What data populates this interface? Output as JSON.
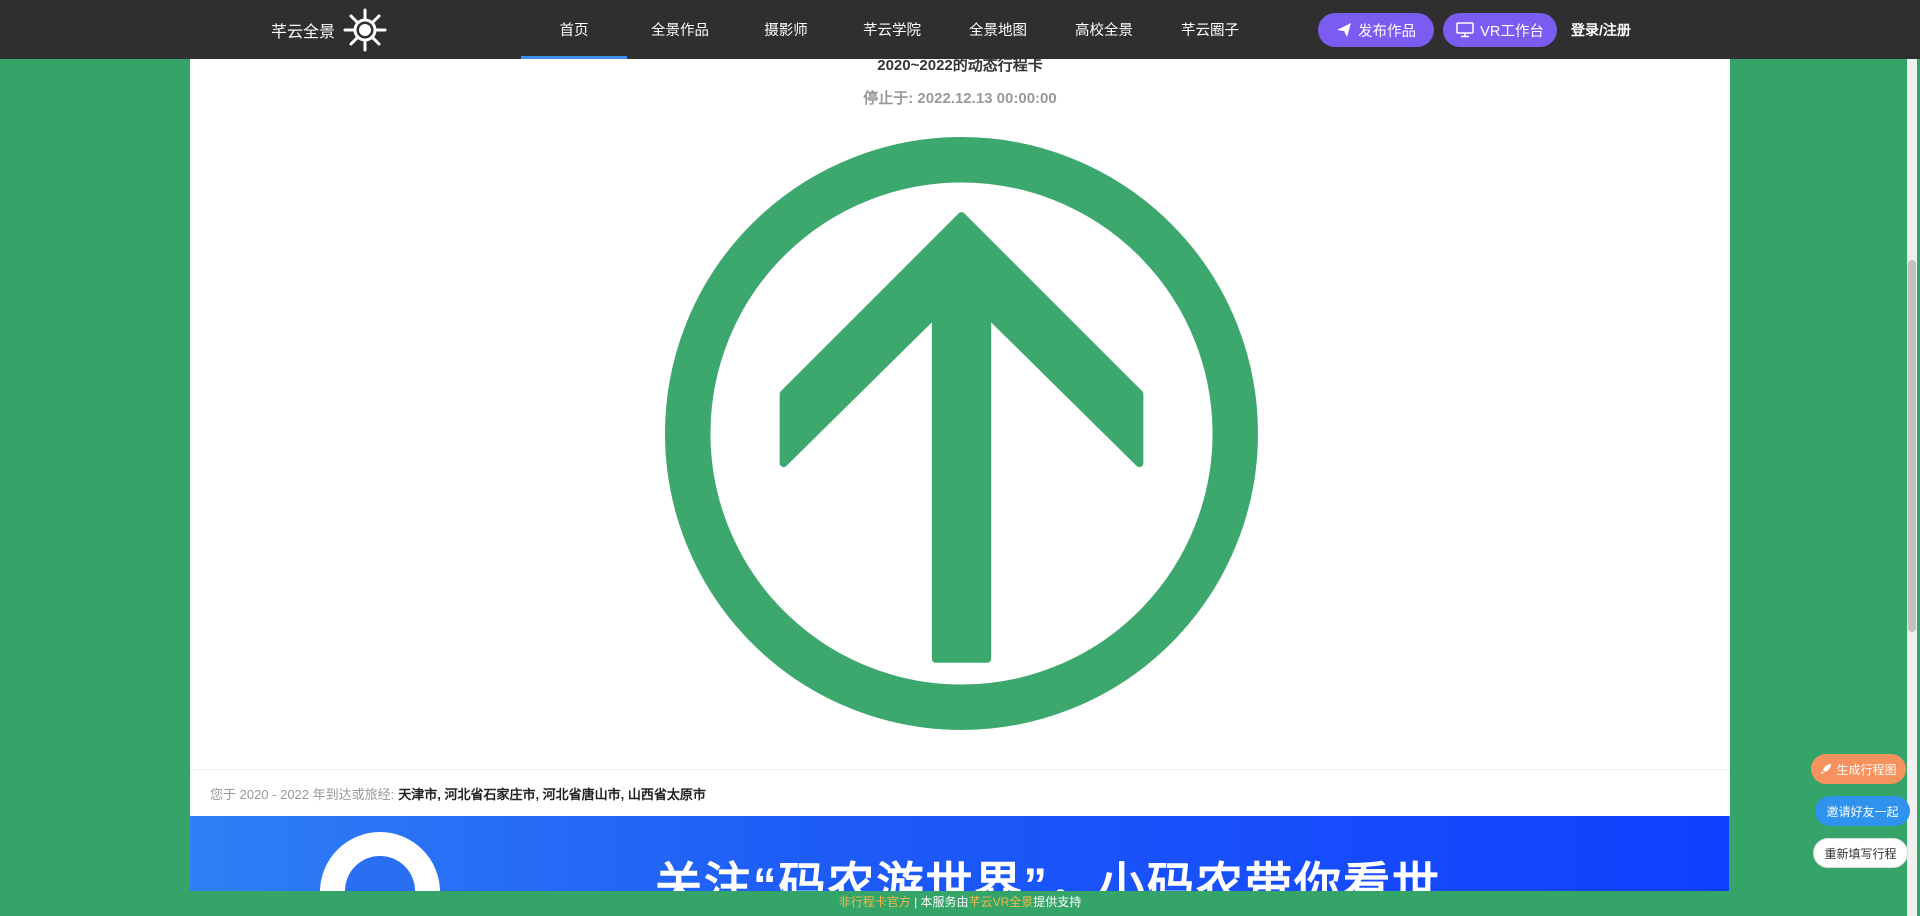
{
  "header": {
    "brand": "芊云全景",
    "nav": [
      "首页",
      "全景作品",
      "摄影师",
      "芊云学院",
      "全景地图",
      "高校全景",
      "芊云圈子"
    ],
    "active_nav": "首页",
    "publish_label": "发布作品",
    "vr_label": "VR工作台",
    "login_label": "登录/注册"
  },
  "card": {
    "title": "2020~2022的动态行程卡",
    "stopped": "停止于: 2022.12.13 00:00:00",
    "cities_label": "您于 2020 - 2022 年到达或旅经:",
    "cities_value": "天津市, 河北省石家庄市, 河北省唐山市, 山西省太原市"
  },
  "banner": {
    "text": "关注“码农游世界”，小码农带你看世"
  },
  "footer": {
    "part1": "非行程卡官方",
    "sep": " | ",
    "part2": "本服务由",
    "part3": "芊云VR全景",
    "part4": "提供支持"
  },
  "float_buttons": {
    "generate": "生成行程图",
    "invite": "邀请好友一起",
    "refill": "重新填写行程"
  },
  "colors": {
    "page_bg": "#35a468",
    "topbar": "#2f2f2f",
    "accent_purple": "#7b5cf0",
    "emblem_green": "#3da86e",
    "active_underline": "#3d8ef0"
  },
  "icons": [
    "logo-wheel-icon",
    "paper-plane-icon",
    "monitor-icon",
    "up-arrow-circle-icon",
    "rocket-icon"
  ]
}
